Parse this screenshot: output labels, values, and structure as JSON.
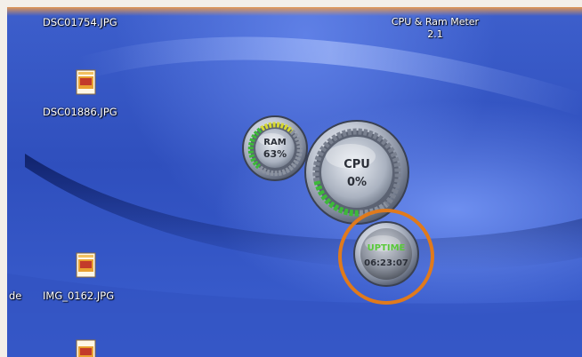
{
  "desktop": {
    "files": [
      {
        "name": "DSC01754.JPG"
      },
      {
        "name": "DSC01886.JPG"
      },
      {
        "name": "IMG_0162.JPG"
      },
      {
        "name": ""
      }
    ],
    "partial_label": "de"
  },
  "gadget": {
    "title_line1": "CPU & Ram Meter",
    "title_line2": "2.1",
    "ram": {
      "label": "RAM",
      "value": "63%",
      "percent": 63
    },
    "cpu": {
      "label": "CPU",
      "value": "0%",
      "percent": 0
    },
    "uptime": {
      "label": "UPTIME",
      "value": "06:23:07"
    }
  },
  "annotation": {
    "highlight_color": "#e07a1c",
    "target": "uptime"
  },
  "colors": {
    "desktop_blue": "#3d5fcc",
    "meter_green": "#3db83a",
    "meter_yellow": "#d6d832",
    "uptime_green": "#59c93a"
  }
}
